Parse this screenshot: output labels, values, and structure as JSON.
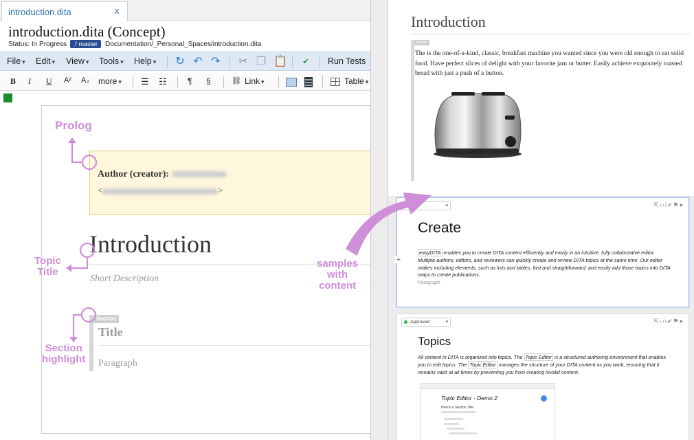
{
  "editor": {
    "tab": {
      "label": "introduction.dita",
      "close": "x"
    },
    "doc_title": "introduction.dita (Concept)",
    "status_text": "Status: In Progress",
    "branch": "master",
    "path": "Documentation/_Personal_Spaces/introduction.dita",
    "menu": [
      "File",
      "Edit",
      "View",
      "Tools",
      "Help"
    ],
    "run_tests": "Run Tests",
    "format": {
      "bold": "B",
      "italic": "I",
      "underline": "U",
      "superscript": "A²",
      "subscript": "A₂",
      "more": "more",
      "pilcrow": "¶",
      "section_sign": "§",
      "link": "Link",
      "table": "Table"
    },
    "prolog": {
      "author_label": "Author (creator):",
      "author_name_lt": "<",
      "author_email_gt": ">"
    },
    "topic_title": "Introduction",
    "short_description": "Short Description",
    "section": {
      "tag": "Section",
      "title": "Title",
      "paragraph": "Paragraph"
    }
  },
  "annotations": {
    "prolog": "Prolog",
    "topic_title": [
      "Topic",
      "Title"
    ],
    "section_highlight": [
      "Section",
      "highlight"
    ],
    "samples": [
      "samples",
      "with",
      "content"
    ]
  },
  "preview": {
    "title": "Introduction",
    "section_tag": "section",
    "paragraph": "The is the one-of-a-kind, classic, breakfast machine you wanted since you were old enough to eat solid food. Have perfect slices of delight with your favorite jam or butter. Easily achieve exquisitely toasted bread with just a push of a button.",
    "cards": [
      {
        "status": "",
        "title": "Create",
        "text_brand": "easyDITA",
        "text": " enables you to create DITA content efficiently and easily in an intuitive, fully collaborative editor. Multiple authors, editors, and reviewers can quickly create and review DITA topics at the same time. Our editor makes including elements, such as lists and tables, fast and straightforward, and easily add those topics into DITA maps to create publications.",
        "paragraph_label": "Paragraph"
      },
      {
        "status": "Approved",
        "title": "Topics",
        "text_pre": "All content in DITA is organized into topics. The ",
        "text_hl1": "Topic Editor",
        "text_mid": " is a structured authoring environment that enables you to edit topics. The ",
        "text_hl2": "Topic Editor",
        "text_post": " manages the structure of your DITA content as you work, ensuring that it remains valid at all times by preventing you from creating invalid content.",
        "mini_title": "Topic Editor - Demo 2",
        "mini_subtitle": "Here's a Section Title"
      }
    ]
  },
  "colors": {
    "accent": "#274d90",
    "annotation": "#cf8fd8",
    "menubar": "#dde9f5",
    "prolog_bg": "#fef7dc"
  }
}
